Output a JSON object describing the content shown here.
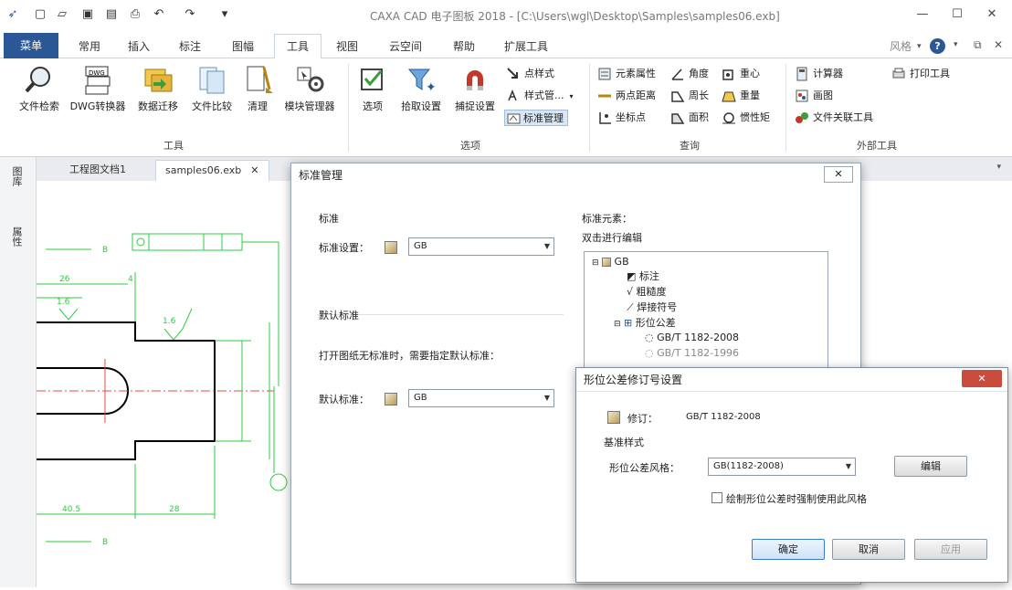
{
  "window": {
    "title": "CAXA CAD 电子图板 2018 - [C:\\Users\\wgl\\Desktop\\Samples\\samples06.exb]"
  },
  "ribbon_tabs": [
    "菜单",
    "常用",
    "插入",
    "标注",
    "图幅",
    "工具",
    "视图",
    "云空间",
    "帮助",
    "扩展工具"
  ],
  "right_controls": {
    "style_label": "风格"
  },
  "ribbon": {
    "tools_group": {
      "label": "工具",
      "buttons": [
        "文件检索",
        "DWG转换器",
        "数据迁移",
        "文件比较",
        "清理",
        "模块管理器"
      ]
    },
    "options_group": {
      "label": "选项",
      "buttons": [
        "选项",
        "拾取设置",
        "捕捉设置"
      ],
      "small": [
        "点样式",
        "样式管...",
        "标准管理"
      ]
    },
    "query_group": {
      "label": "查询",
      "col1": [
        "元素属性",
        "两点距离",
        "坐标点"
      ],
      "col2": [
        "角度",
        "周长",
        "面积"
      ],
      "col3": [
        "重心",
        "重量",
        "惯性矩"
      ]
    },
    "external_group": {
      "label": "外部工具",
      "col1": [
        "计算器",
        "画图",
        "文件关联工具"
      ],
      "col2": [
        "打印工具"
      ]
    }
  },
  "doc_tabs": [
    "工程图文档1",
    "samples06.exb"
  ],
  "left_panels": [
    "图库",
    "属性"
  ],
  "drawing": {
    "dims": [
      "26",
      "4",
      "1.6",
      "1.6",
      "40.5",
      "28",
      "B",
      "B",
      "B"
    ]
  },
  "std_dialog": {
    "title": "标准管理",
    "std_section": "标准",
    "std_setting_label": "标准设置：",
    "std_setting_value": "GB",
    "default_section": "默认标准",
    "default_note": "打开图纸无标准时，需要指定默认标准：",
    "default_label": "默认标准：",
    "default_value": "GB",
    "elements_label": "标准元素：",
    "elements_hint": "双击进行编辑",
    "tree": {
      "root": "GB",
      "items": [
        "标注",
        "粗糙度",
        "焊接符号",
        "形位公差"
      ],
      "sub": [
        "GB/T 1182-2008",
        "GB/T 1182-1996"
      ]
    }
  },
  "rev_dialog": {
    "title": "形位公差修订号设置",
    "revision_label": "修订：",
    "revision_value": "GB/T 1182-2008",
    "section": "基准样式",
    "style_label": "形位公差风格：",
    "style_value": "GB(1182-2008)",
    "edit_button": "编辑",
    "checkbox_label": "绘制形位公差时强制使用此风格",
    "ok": "确定",
    "cancel": "取消",
    "apply": "应用"
  }
}
